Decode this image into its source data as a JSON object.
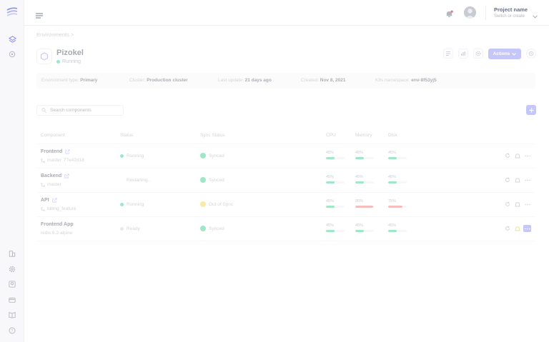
{
  "topbar": {
    "project_name": "Project name",
    "project_hint": "Switch or create"
  },
  "breadcrumb": {
    "label": "Environments",
    "separator": ">"
  },
  "environment": {
    "name": "Pizokel",
    "status": "Running",
    "actions_label": "Actions"
  },
  "info": {
    "type_label": "Environment type:",
    "type_value": "Primary",
    "cluster_label": "Cluster:",
    "cluster_value": "Production cluster",
    "update_label": "Last update:",
    "update_value": "21 days ago",
    "created_label": "Created:",
    "created_value": "Nov 8, 2021",
    "ns_label": "K8s namespace:",
    "ns_value": "env-8f53yj5"
  },
  "search": {
    "placeholder": "Search components"
  },
  "table": {
    "columns": {
      "component": "Component",
      "status": "Status",
      "sync": "Sync Status",
      "cpu": "CPU",
      "memory": "Memory",
      "disk": "Disk"
    },
    "rows": [
      {
        "name": "Frontend",
        "sub": "master",
        "commit": "77e42d18",
        "status": "Running",
        "sync": "Synced",
        "cpu": "45%",
        "memory": "45%",
        "disk": "45%"
      },
      {
        "name": "Backend",
        "sub": "master",
        "commit": "",
        "status": "Restarting...",
        "sync": "Synced",
        "cpu": "45%",
        "memory": "45%",
        "disk": "45%"
      },
      {
        "name": "API",
        "sub": "billing_feature",
        "commit": "",
        "status": "Running",
        "sync": "Out of Sync",
        "cpu": "45%",
        "memory": "95%",
        "disk": "75%"
      },
      {
        "name": "Frontend App",
        "sub": "redis:6.2-alpine",
        "commit": "",
        "status": "Ready",
        "sync": "Synced",
        "cpu": "45%",
        "memory": "45%",
        "disk": "45%"
      }
    ]
  },
  "colors": {
    "accent": "#8b8ef0",
    "running": "#3ecf8e",
    "warning": "#f5d547",
    "danger": "#ef7b7b",
    "ready": "#d0d3da"
  }
}
